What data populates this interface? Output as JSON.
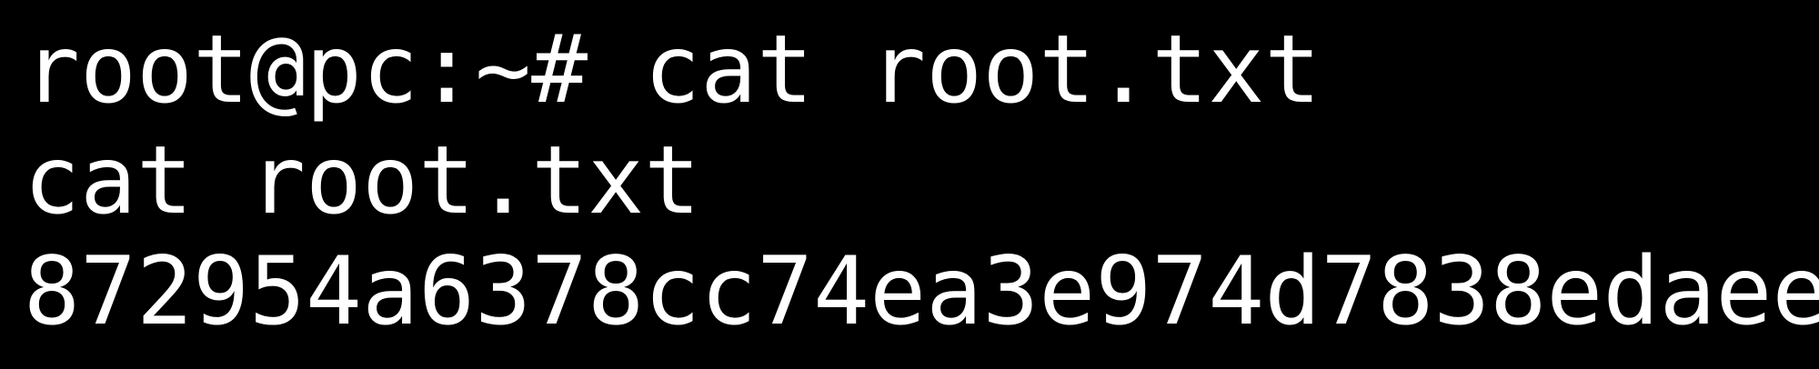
{
  "terminal": {
    "background": "#000000",
    "foreground": "#ffffff",
    "lines": [
      "root@pc:~# cat root.txt",
      "cat root.txt",
      "872954a6378cc74ea3e974d7838edaee"
    ]
  }
}
